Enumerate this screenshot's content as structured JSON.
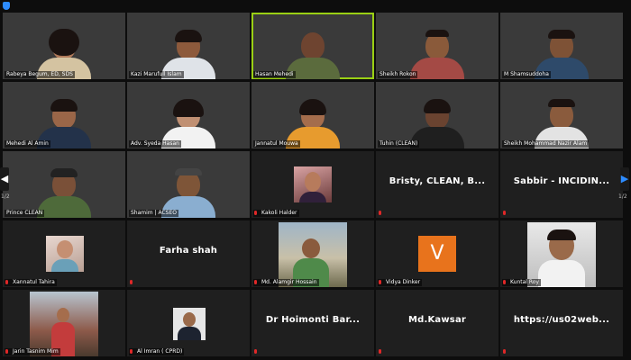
{
  "navigation": {
    "prev_arrow": "◀",
    "next_arrow": "▶",
    "page_left": "1/2",
    "page_right": "1/2"
  },
  "participants": [
    {
      "name": "Rabeya Begum, ED, SDS",
      "video": true
    },
    {
      "name": "Kazi Marufull Islam",
      "video": true
    },
    {
      "name": "Hasan Mehedi",
      "video": true,
      "active_speaker": true
    },
    {
      "name": "Sheikh Rokon",
      "video": true
    },
    {
      "name": "M Shamsuddoha",
      "video": true
    },
    {
      "name": "Mehedi Al Amin",
      "video": true
    },
    {
      "name": "Adv. Syeda Hasan",
      "video": true
    },
    {
      "name": "Jannatul Mouwa",
      "video": true
    },
    {
      "name": "Tuhin (CLEAN)",
      "video": true
    },
    {
      "name": "Sheikh Mohammad Nazir Alam",
      "video": true
    },
    {
      "name": "Prince CLEAN",
      "video": true
    },
    {
      "name": "Shamim | ACSEO",
      "video": true
    },
    {
      "name": "Kakoli Halder",
      "video": false,
      "has_photo": true
    },
    {
      "name": "",
      "video": false,
      "display_name": "Bristy, CLEAN, B..."
    },
    {
      "name": "",
      "video": false,
      "display_name": "Sabbir - INCIDIN..."
    },
    {
      "name": "Xannatul Tahira",
      "video": false,
      "has_photo": true
    },
    {
      "name": "",
      "video": false,
      "display_name": "Farha shah"
    },
    {
      "name": "Md. Alamgir Hossain",
      "video": false,
      "has_photo": true
    },
    {
      "name": "Vidya Dinker",
      "video": false,
      "avatar_letter": "V"
    },
    {
      "name": "Kuntal Roy",
      "video": false,
      "has_photo": true
    },
    {
      "name": "Jarin Tasnim Mim",
      "video": false,
      "has_photo": true
    },
    {
      "name": "Al Imran ( CPRD)",
      "video": false,
      "has_photo": true
    },
    {
      "name": "",
      "video": false,
      "display_name": "Dr Hoimonti Bar..."
    },
    {
      "name": "",
      "video": false,
      "display_name": "Md.Kawsar"
    },
    {
      "name": "",
      "video": false,
      "display_name": "https://us02web..."
    }
  ],
  "colors": {
    "active_border": "#9ad014",
    "muted_mic": "#e02828",
    "avatar_orange": "#e8731c"
  }
}
